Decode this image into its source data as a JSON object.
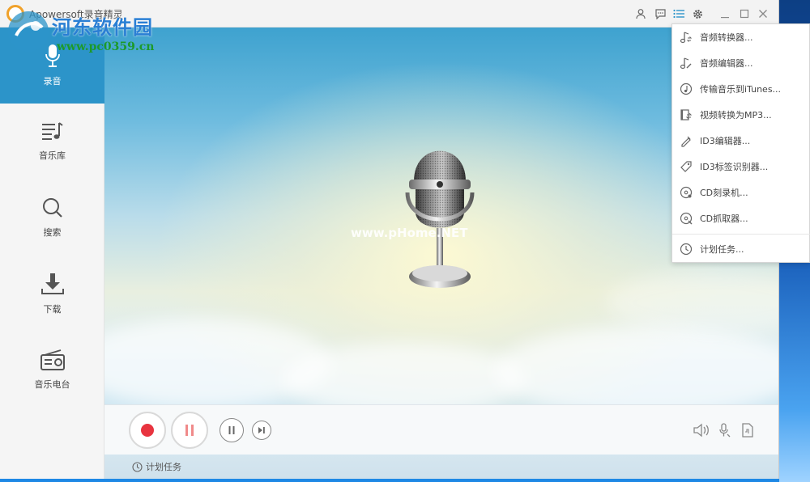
{
  "window": {
    "title": "Apowersoft录音精灵"
  },
  "watermark": {
    "site_name": "河东软件园",
    "site_url": "www.pc0359.cn",
    "stage_mark": "www.pHome.NET"
  },
  "titlebar": {
    "icons": [
      "user-icon",
      "feedback-icon",
      "menu-list-icon",
      "gear-icon",
      "minimize-icon",
      "maximize-icon",
      "close-icon"
    ]
  },
  "sidebar": {
    "items": [
      {
        "label": "录音",
        "icon": "microphone-icon",
        "active": true
      },
      {
        "label": "音乐库",
        "icon": "music-library-icon",
        "active": false
      },
      {
        "label": "搜索",
        "icon": "search-icon",
        "active": false
      },
      {
        "label": "下载",
        "icon": "download-icon",
        "active": false
      },
      {
        "label": "音乐电台",
        "icon": "radio-icon",
        "active": false
      }
    ]
  },
  "menu": {
    "items": [
      {
        "label": "音频转换器...",
        "icon": "audio-convert-icon"
      },
      {
        "label": "音频编辑器...",
        "icon": "audio-edit-icon"
      },
      {
        "label": "传输音乐到iTunes...",
        "icon": "itunes-icon"
      },
      {
        "label": "视频转换为MP3...",
        "icon": "video-convert-icon"
      },
      {
        "label": "ID3编辑器...",
        "icon": "id3-edit-icon"
      },
      {
        "label": "ID3标签识别器...",
        "icon": "tag-icon"
      },
      {
        "label": "CD刻录机...",
        "icon": "cd-burn-icon"
      },
      {
        "label": "CD抓取器...",
        "icon": "cd-rip-icon"
      },
      {
        "label": "计划任务...",
        "icon": "clock-icon"
      }
    ]
  },
  "controls": {
    "record": "record-icon",
    "pause_recording": "pause-icon",
    "pause": "pause-small-icon",
    "next": "next-icon",
    "volume": "speaker-icon",
    "mic": "mic-small-icon",
    "file": "file-icon"
  },
  "status": {
    "schedule_label": "计划任务"
  },
  "colors": {
    "accent": "#2c94c9",
    "record_red": "#e8343f",
    "pause_red": "#f08a8a"
  }
}
